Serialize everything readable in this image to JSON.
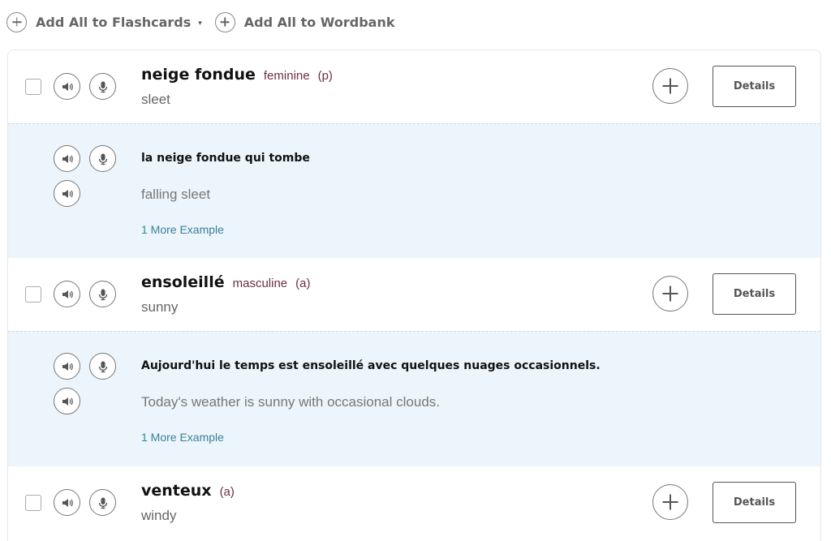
{
  "toolbar": {
    "add_flashcards_label": "Add All to Flashcards",
    "add_wordbank_label": "Add All to Wordbank",
    "caret": "▾"
  },
  "entries": [
    {
      "word": "neige fondue",
      "gender": "feminine",
      "pos": "(p)",
      "translation": "sleet",
      "example": {
        "text": "la neige fondue qui tombe",
        "translation": "falling sleet",
        "more_label": "1 More Example"
      }
    },
    {
      "word": "ensoleillé",
      "gender": "masculine",
      "pos": "(a)",
      "translation": "sunny",
      "example": {
        "text": "Aujourd'hui le temps est ensoleillé avec quelques nuages occasionnels.",
        "translation": "Today's weather is sunny with occasional clouds.",
        "more_label": "1 More Example"
      }
    },
    {
      "word": "venteux",
      "gender": "",
      "pos": "(a)",
      "translation": "windy"
    }
  ],
  "details_label": "Details",
  "colors": {
    "example_bg": "#ebf5fb",
    "gender_text": "#6b3040",
    "link": "#3e7f97"
  },
  "icons": [
    "plus-icon",
    "speaker-icon",
    "microphone-icon",
    "caret-down-icon"
  ]
}
